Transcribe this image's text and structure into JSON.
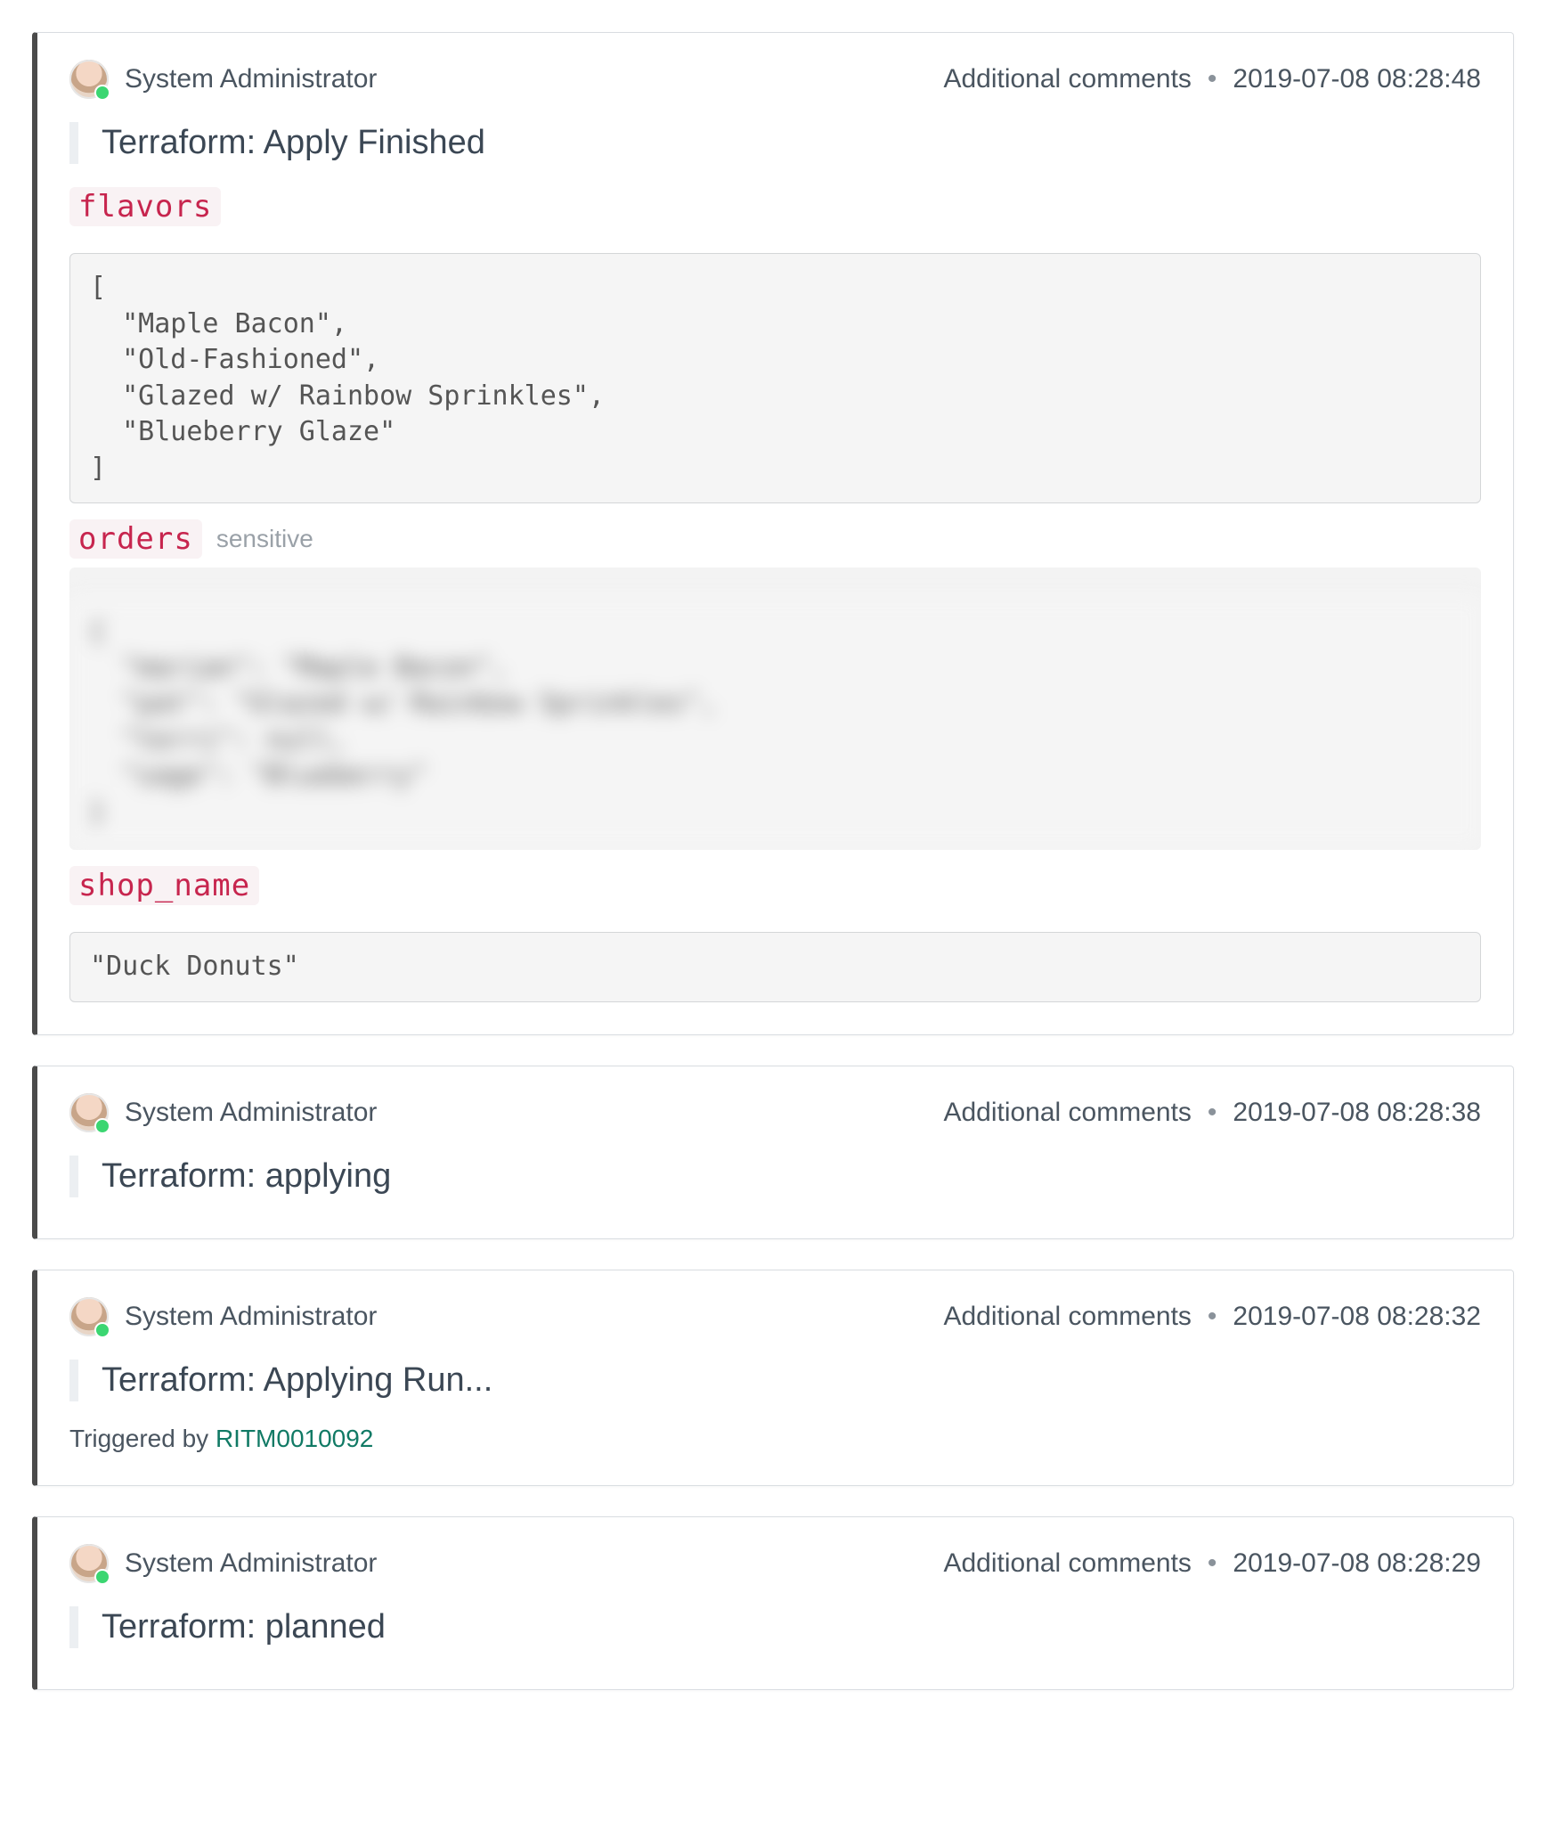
{
  "comments": [
    {
      "user": "System Administrator",
      "meta_label": "Additional comments",
      "timestamp": "2019-07-08 08:28:48",
      "title": "Terraform: Apply Finished",
      "outputs": [
        {
          "key": "flavors",
          "sensitive": false,
          "value": "[\n  \"Maple Bacon\",\n  \"Old-Fashioned\",\n  \"Glazed w/ Rainbow Sprinkles\",\n  \"Blueberry Glaze\"\n]"
        },
        {
          "key": "orders",
          "sensitive": true,
          "sensitive_label": "sensitive",
          "value": "{\n  \"marian\": \"Maple Bacon\",\n  \"pat\": \"Glazed w/ Rainbow Sprinkles\",\n  \"terri\": null,\n  \"sage\": \"Blueberry\"\n}"
        },
        {
          "key": "shop_name",
          "sensitive": false,
          "value": "\"Duck Donuts\""
        }
      ]
    },
    {
      "user": "System Administrator",
      "meta_label": "Additional comments",
      "timestamp": "2019-07-08 08:28:38",
      "title": "Terraform: applying"
    },
    {
      "user": "System Administrator",
      "meta_label": "Additional comments",
      "timestamp": "2019-07-08 08:28:32",
      "title": "Terraform: Applying Run...",
      "triggered_prefix": "Triggered by ",
      "triggered_link": "RITM0010092"
    },
    {
      "user": "System Administrator",
      "meta_label": "Additional comments",
      "timestamp": "2019-07-08 08:28:29",
      "title": "Terraform: planned"
    }
  ]
}
